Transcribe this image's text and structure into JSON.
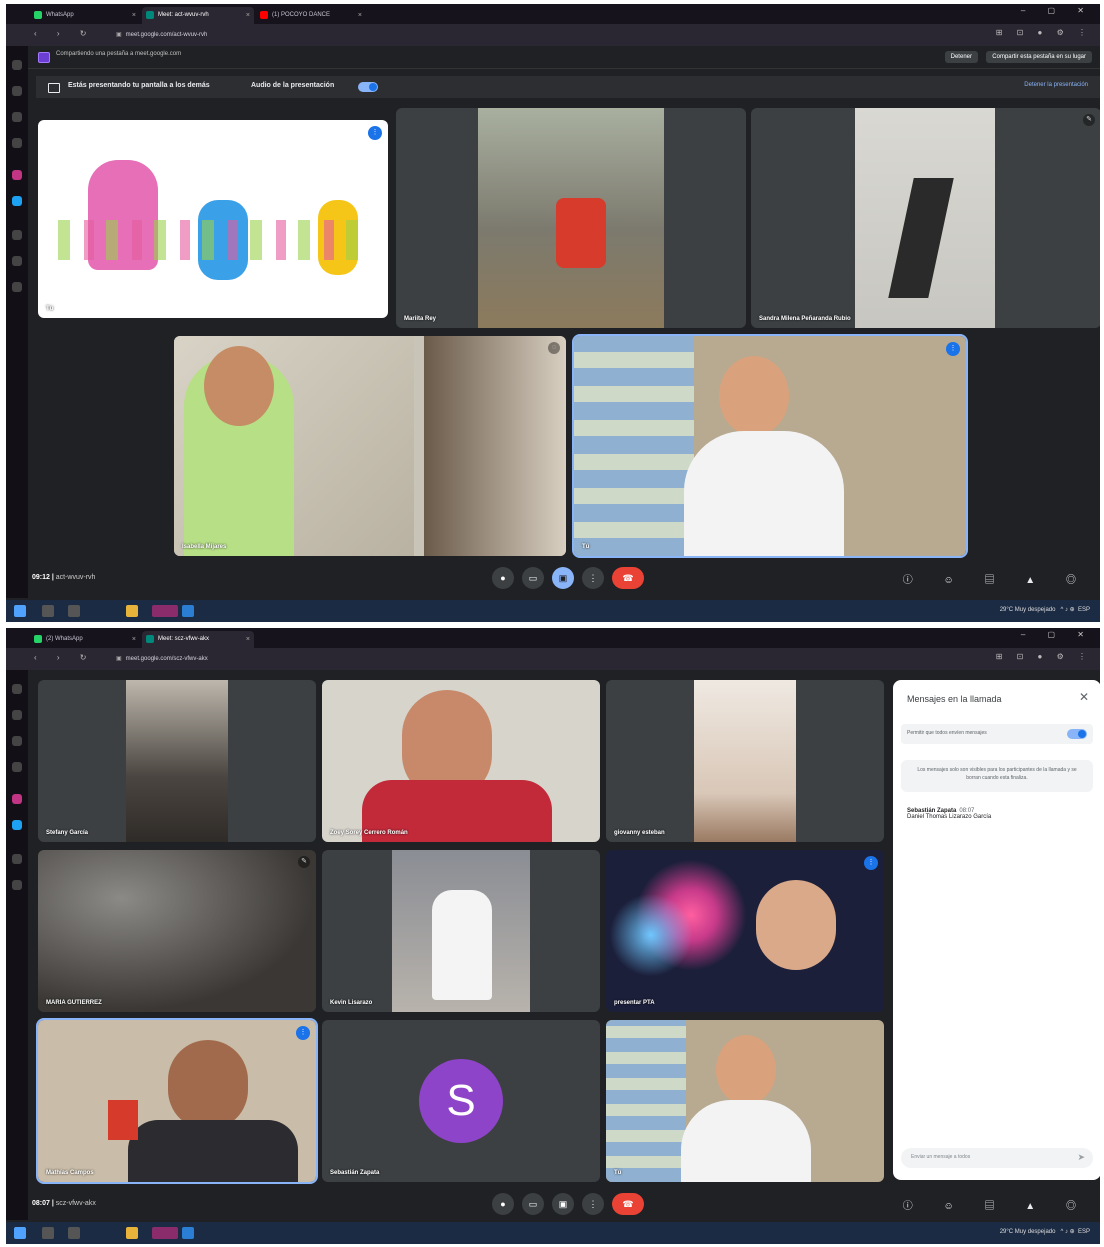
{
  "browser": {
    "tabs_top": [
      "WhatsApp",
      "Meet: act-wvuv-rvh",
      "(1) POCOYO DANCE"
    ],
    "tabs_bottom": [
      "(2) WhatsApp",
      "Meet: scz-vfwv-akx"
    ],
    "url_top": "meet.google.com/act-wvuv-rvh",
    "url_bottom": "meet.google.com/scz-vfwv-akx"
  },
  "share_bar": {
    "text": "Compartiendo una pestaña a meet.google.com",
    "stop_label": "Detener",
    "share_label": "Compartir esta pestaña en su lugar"
  },
  "presentation_bar": {
    "text": "Estás presentando tu pantalla a los demás",
    "audio_label": "Audio de la presentación",
    "stop_label": "Detener la presentación"
  },
  "screen1": {
    "tiles": [
      {
        "name": "Tú"
      },
      {
        "name": "Mariita Rey"
      },
      {
        "name": "Sandra Milena Peñaranda Rubio"
      },
      {
        "name": "Isabella Mijares"
      },
      {
        "name": "Tú"
      }
    ],
    "clock": "09:12",
    "meeting_code": "act-wvuv-rvh"
  },
  "screen2": {
    "tiles": [
      {
        "name": "Stefany García"
      },
      {
        "name": "Zoey Sorey Cerrero Román"
      },
      {
        "name": "giovanny esteban"
      },
      {
        "name": "MARIA GUTIERREZ"
      },
      {
        "name": "Kevin Lisarazo"
      },
      {
        "name": "presentar PTA"
      },
      {
        "name": "Mathías Campos"
      },
      {
        "name": "Sebastián Zapata",
        "initial": "S"
      },
      {
        "name": "Tú"
      }
    ],
    "clock": "08:07",
    "meeting_code": "scz-vfwv-akx"
  },
  "chat": {
    "title": "Mensajes en la llamada",
    "permission": "Permitir que todos envíen mensajes",
    "note": "Los mensajes solo son visibles para los participantes de la llamada y se borran cuando esta finaliza.",
    "sender": "Sebastián Zapata",
    "time": "08:07",
    "message": "Daniel Thomas Lizarazo García",
    "placeholder": "Enviar un mensaje a todos"
  },
  "taskbar": {
    "weather": "29°C Muy despejado",
    "lang": "ESP"
  },
  "colors": {
    "accent": "#8ab4f8",
    "end_call": "#ea4335",
    "meet_bg": "#202124",
    "avatar": "#8e44c9"
  }
}
